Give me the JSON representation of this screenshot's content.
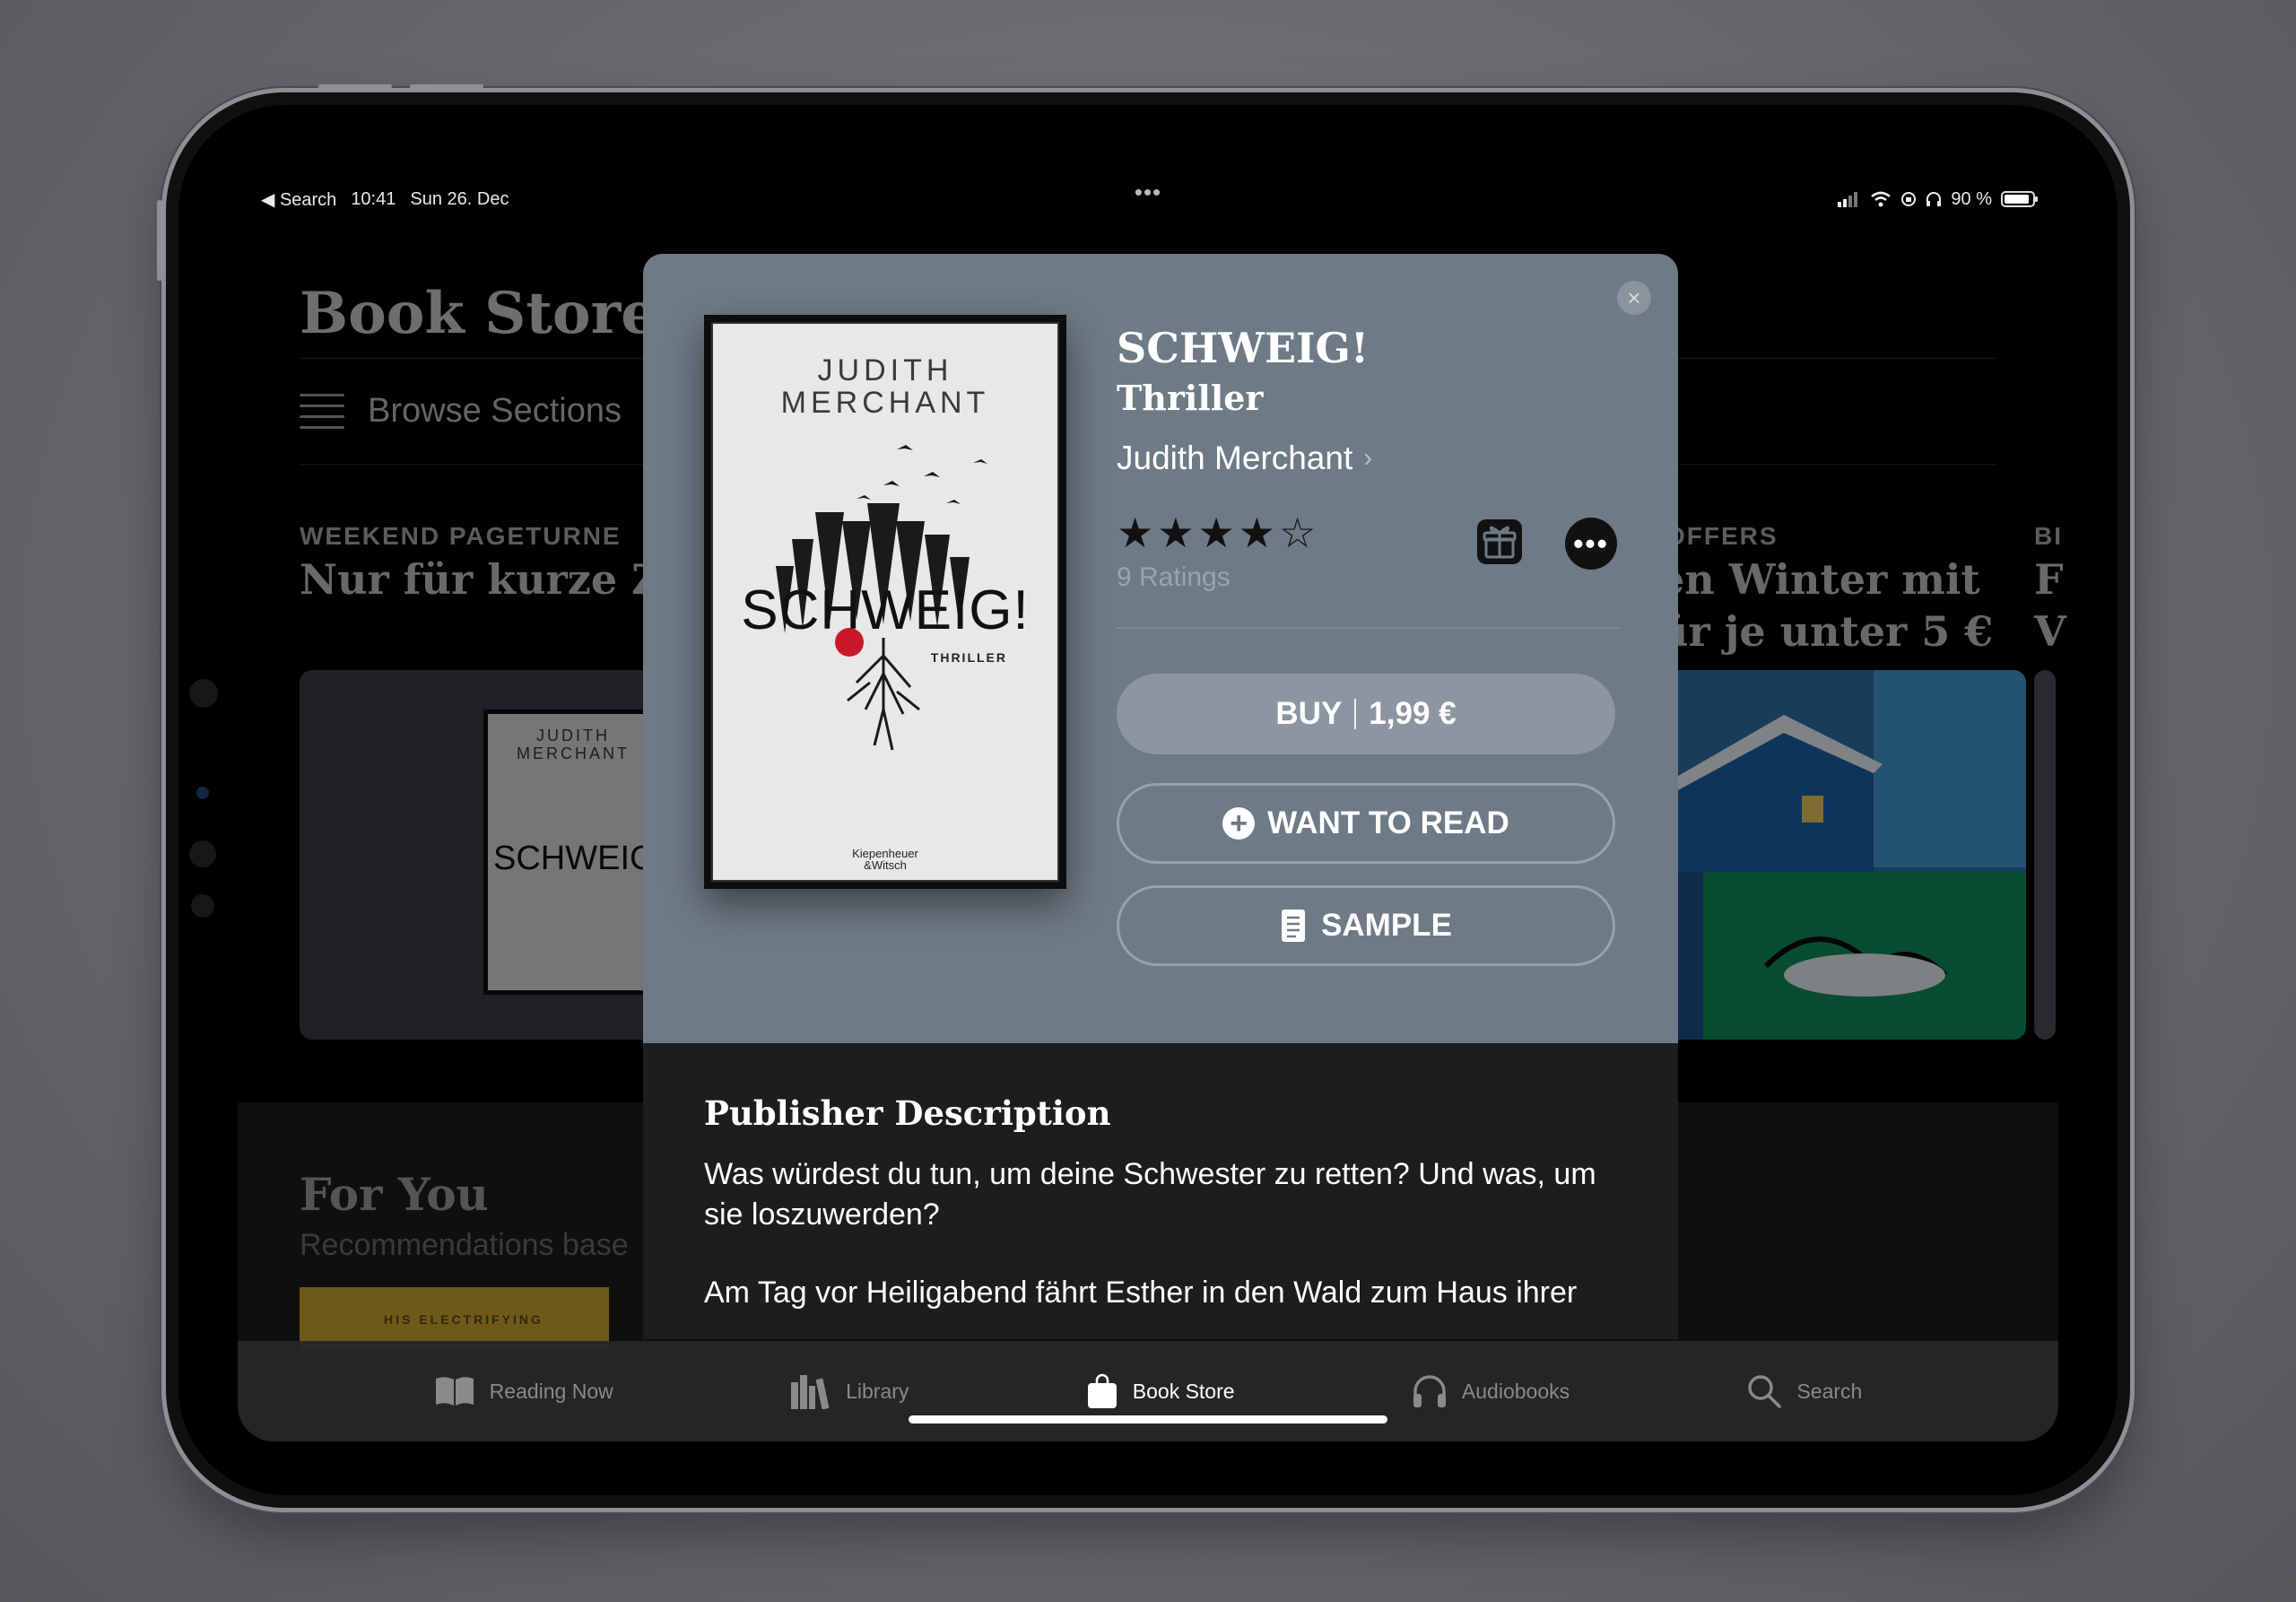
{
  "status_bar": {
    "back_label": "◀ Search",
    "time": "10:41",
    "date": "Sun 26. Dec",
    "battery": "90 %"
  },
  "store": {
    "title": "Book Store",
    "browse_label": "Browse Sections",
    "sections": [
      {
        "label": "WEEKEND PAGETURNE",
        "title": "Nur für kurze Ze"
      },
      {
        "label": "OFFERS",
        "title_line1": "en Winter mit",
        "title_line2": "ür je unter 5 €"
      },
      {
        "label": "BI",
        "title_line1": "F",
        "title_line2": "V"
      }
    ],
    "for_you": {
      "title": "For You",
      "subtitle": "Recommendations base",
      "book_strip_text": "HIS ELECTRIFYING"
    }
  },
  "book": {
    "title": "SCHWEIG!",
    "genre": "Thriller",
    "author": "Judith Merchant",
    "rating": 4,
    "ratings_count": "9 Ratings",
    "cover": {
      "author_line1": "JUDITH",
      "author_line2": "MERCHANT",
      "title": "SCHWEIG!",
      "subtitle": "THRILLER",
      "publisher_line1": "Kiepenheuer",
      "publisher_line2": "&Witsch"
    },
    "buy_label": "BUY",
    "price": "1,99 €",
    "want_label": "WANT TO READ",
    "sample_label": "SAMPLE",
    "description_heading": "Publisher Description",
    "description_p1": "Was würdest du tun, um deine Schwester zu retten? Und was, um sie loszuwerden?",
    "description_p2": "Am Tag vor Heiligabend fährt Esther in den Wald zum Haus ihrer"
  },
  "tabs": [
    {
      "label": "Reading Now",
      "icon": "book-open-icon",
      "active": false
    },
    {
      "label": "Library",
      "icon": "library-icon",
      "active": false
    },
    {
      "label": "Book Store",
      "icon": "shopping-bag-icon",
      "active": true
    },
    {
      "label": "Audiobooks",
      "icon": "headphones-icon",
      "active": false
    },
    {
      "label": "Search",
      "icon": "magnifier-icon",
      "active": false
    }
  ],
  "colors": {
    "modal_header": "#6e7a85",
    "buy_button": "#8c96a0",
    "sheet_background": "#1d1d1f"
  }
}
